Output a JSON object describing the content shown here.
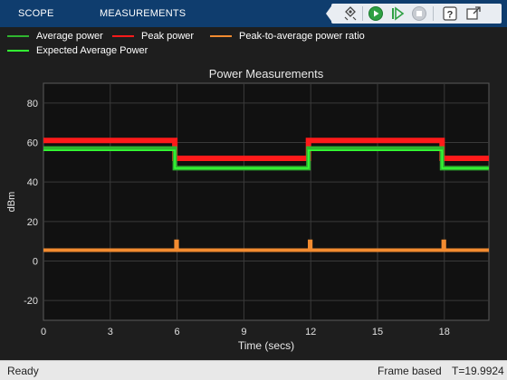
{
  "toolstrip": {
    "tabs": [
      {
        "label": "SCOPE"
      },
      {
        "label": "MEASUREMENTS"
      }
    ],
    "quick_access": [
      "snapshot-icon",
      "run-icon",
      "step-forward-icon",
      "stop-icon",
      "help-icon",
      "undock-icon"
    ]
  },
  "legend": {
    "items": [
      {
        "label": "Average power",
        "color": "#2fb52f"
      },
      {
        "label": "Peak power",
        "color": "#ff1a1a"
      },
      {
        "label": "Peak-to-average power ratio",
        "color": "#f28b30"
      },
      {
        "label": "Expected Average Power",
        "color": "#33ff33"
      }
    ]
  },
  "chart_data": {
    "type": "line",
    "title": "Power Measurements",
    "xlabel": "Time (secs)",
    "ylabel": "dBm",
    "xlim": [
      0,
      20
    ],
    "ylim": [
      -30,
      90
    ],
    "xticks": [
      0,
      3,
      6,
      9,
      12,
      15,
      18
    ],
    "yticks": [
      -20,
      0,
      20,
      40,
      60,
      80
    ],
    "grid": true,
    "background": "#111111",
    "series": [
      {
        "name": "Peak power",
        "color": "#ff1a1a",
        "x": [
          0,
          5.9,
          5.9,
          11.9,
          11.9,
          17.9,
          17.9,
          20
        ],
        "y": [
          61,
          61,
          52,
          52,
          61,
          61,
          52,
          52
        ]
      },
      {
        "name": "Average power",
        "color": "#2fb52f",
        "x": [
          0,
          5.9,
          5.9,
          11.9,
          11.9,
          17.9,
          17.9,
          20
        ],
        "y": [
          57,
          57,
          47,
          47,
          57,
          57,
          47,
          47
        ]
      },
      {
        "name": "Expected Average Power",
        "color": "#33ff33",
        "x": [
          0,
          5.9,
          5.9,
          11.9,
          11.9,
          17.9,
          17.9,
          20
        ],
        "y": [
          56,
          56,
          47,
          47,
          56,
          56,
          47,
          47
        ]
      },
      {
        "name": "Peak-to-average power ratio",
        "color": "#f28b30",
        "x": [
          0,
          5.95,
          5.95,
          6.0,
          6.0,
          11.95,
          11.95,
          12.0,
          12.0,
          17.95,
          17.95,
          18.0,
          18.0,
          20
        ],
        "y": [
          5.5,
          5.5,
          10,
          10,
          5.5,
          5.5,
          10,
          10,
          5.5,
          5.5,
          10,
          10,
          5.5,
          5.5
        ]
      }
    ]
  },
  "status": {
    "left": "Ready",
    "mode": "Frame based",
    "time": "T=19.9924"
  }
}
